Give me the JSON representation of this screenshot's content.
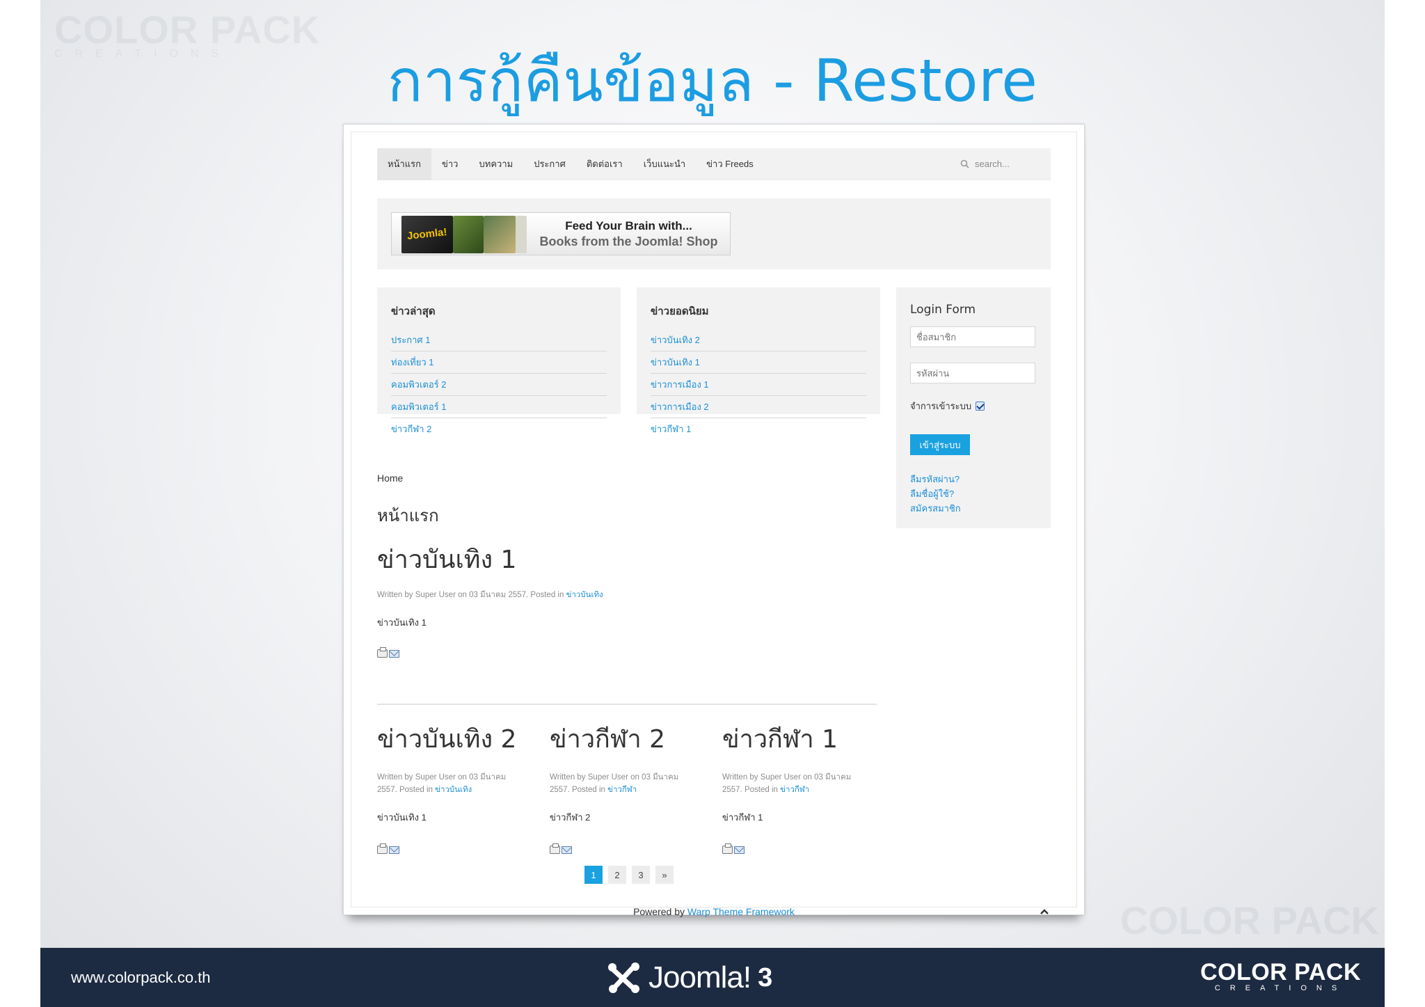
{
  "slide": {
    "title": "การกู้คืนข้อมูล - Restore",
    "watermark": "COLOR PACK",
    "watermark_sub": "CREATIONS"
  },
  "site": {
    "nav": {
      "items": [
        "หน้าแรก",
        "ข่าว",
        "บทความ",
        "ประกาศ",
        "ติดต่อเรา",
        "เว็บแนะนำ",
        "ข่าว Freeds"
      ],
      "search_placeholder": "search..."
    },
    "banner": {
      "line1": "Feed Your Brain with...",
      "line2": "Books from the Joomla! Shop",
      "book_label": "Joomla!"
    },
    "latest_news": {
      "title": "ข่าวล่าสุด",
      "items": [
        "ประกาศ 1",
        "ท่องเที่ยว 1",
        "คอมพิวเตอร์ 2",
        "คอมพิวเตอร์ 1",
        "ข่าวกีฬา 2"
      ]
    },
    "popular_news": {
      "title": "ข่าวยอดนิยม",
      "items": [
        "ข่าวบันเทิง 2",
        "ข่าวบันเทิง 1",
        "ข่าวการเมือง 1",
        "ข่าวการเมือง 2",
        "ข่าวกีฬา 1"
      ]
    },
    "login": {
      "title": "Login Form",
      "username_placeholder": "ชื่อสมาชิก",
      "password_placeholder": "รหัสผ่าน",
      "remember_label": "จำการเข้าระบบ",
      "submit_label": "เข้าสู่ระบบ",
      "links": [
        "ลืมรหัสผ่าน?",
        "ลืมชื่อผู้ใช้?",
        "สมัครสมาชิก"
      ]
    },
    "breadcrumb": "Home",
    "page_heading": "หน้าแรก",
    "lead_article": {
      "title": "ข่าวบันเทิง 1",
      "meta": "Written by Super User on 03 มีนาคม 2557. Posted in",
      "category": "ข่าวบันเทิง",
      "body": "ข่าวบันเทิง 1"
    },
    "articles": [
      {
        "title": "ข่าวบันเทิง 2",
        "meta_line1": "Written by Super User on 03 มีนาคม",
        "meta_line2": "2557. Posted in",
        "category": "ข่าวบันเทิง",
        "body": "ข่าวบันเทิง 1"
      },
      {
        "title": "ข่าวกีฬา 2",
        "meta_line1": "Written by Super User on 03 มีนาคม",
        "meta_line2": "2557. Posted in",
        "category": "ข่าวกีฬา",
        "body": "ข่าวกีฬา 2"
      },
      {
        "title": "ข่าวกีฬา 1",
        "meta_line1": "Written by Super User on 03 มีนาคม",
        "meta_line2": "2557. Posted in",
        "category": "ข่าวกีฬา",
        "body": "ข่าวกีฬา 1"
      }
    ],
    "pagination": [
      "1",
      "2",
      "3",
      "»"
    ],
    "pagination_current": "1",
    "footer": {
      "powered_by": "Powered by",
      "framework": "Warp Theme Framework"
    }
  },
  "bottom_bar": {
    "url": "www.colorpack.co.th",
    "joomla_word": "Joomla!",
    "joomla_version": "3",
    "brand": "COLOR PACK",
    "brand_sub": "CREATIONS"
  },
  "colors": {
    "title_blue": "#1c9de2",
    "link_blue": "#1c8fd6",
    "button_blue": "#19a1e0",
    "bottom_bar": "#1d2b42",
    "panel_gray": "#f2f2f3"
  }
}
